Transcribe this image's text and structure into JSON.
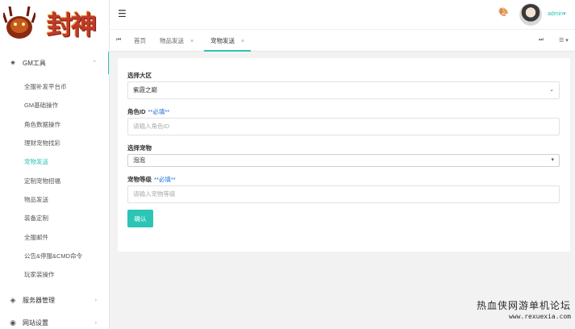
{
  "brand": {
    "logo_text": "封神"
  },
  "header": {
    "menu_icon": "hamburger-icon",
    "theme_icon": "palette-icon",
    "user_name": "admin",
    "user_caret": "▾"
  },
  "sidebar": {
    "groups": [
      {
        "label": "GM工具",
        "icon": "spider-icon",
        "expanded": true
      },
      {
        "label": "服务器管理",
        "icon": "gem-icon",
        "expanded": false
      },
      {
        "label": "网站设置",
        "icon": "globe-icon",
        "expanded": false
      }
    ],
    "gm_items": [
      {
        "label": "全服补发平台币"
      },
      {
        "label": "GM基础操作"
      },
      {
        "label": "角色数据操作"
      },
      {
        "label": "理财宠物找彩"
      },
      {
        "label": "宠物发送",
        "active": true
      },
      {
        "label": "定制宠物招福"
      },
      {
        "label": "物品发送"
      },
      {
        "label": "装备定制"
      },
      {
        "label": "全服邮件"
      },
      {
        "label": "公告&停服&CMD命令"
      },
      {
        "label": "玩家装操作"
      }
    ]
  },
  "tabs": {
    "prev": "⏮",
    "items": [
      {
        "label": "首页",
        "closable": false,
        "active": false
      },
      {
        "label": "物品发送",
        "closable": true,
        "active": false
      },
      {
        "label": "宠物发送",
        "closable": true,
        "active": true
      }
    ],
    "next": "⏭",
    "menu": "☰ ▾",
    "close_glyph": "×"
  },
  "form": {
    "server": {
      "label": "选择大区",
      "value": "紫霞之巅"
    },
    "role_id": {
      "label": "角色ID",
      "required": "**必填**",
      "placeholder": "请输入角色ID"
    },
    "pet": {
      "label": "选择宠物",
      "value": "泡泡"
    },
    "pet_level": {
      "label": "宠物等级",
      "required": "**必填**",
      "placeholder": "请输入宠物等级"
    },
    "submit_label": "确认"
  },
  "watermark": {
    "cn": "热血侠网游单机论坛",
    "url": "www.rexuexia.com"
  },
  "colors": {
    "accent": "#2cc4b5",
    "required_note": "#1e6fd9"
  }
}
